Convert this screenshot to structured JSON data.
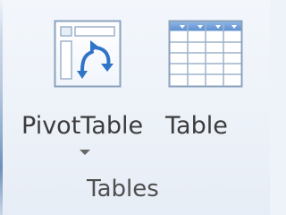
{
  "ribbon": {
    "group_label": "Tables",
    "buttons": {
      "pivottable": {
        "label": "PivotTable",
        "icon": "pivottable-icon",
        "has_dropdown": true
      },
      "table": {
        "label": "Table",
        "icon": "table-icon",
        "has_dropdown": false
      }
    }
  },
  "colors": {
    "background": "#eef3fa",
    "icon_border": "#7f9bb8",
    "accent_blue": "#2f74c7",
    "header_blue": "#7aa5db",
    "text": "#3c3c3c"
  }
}
